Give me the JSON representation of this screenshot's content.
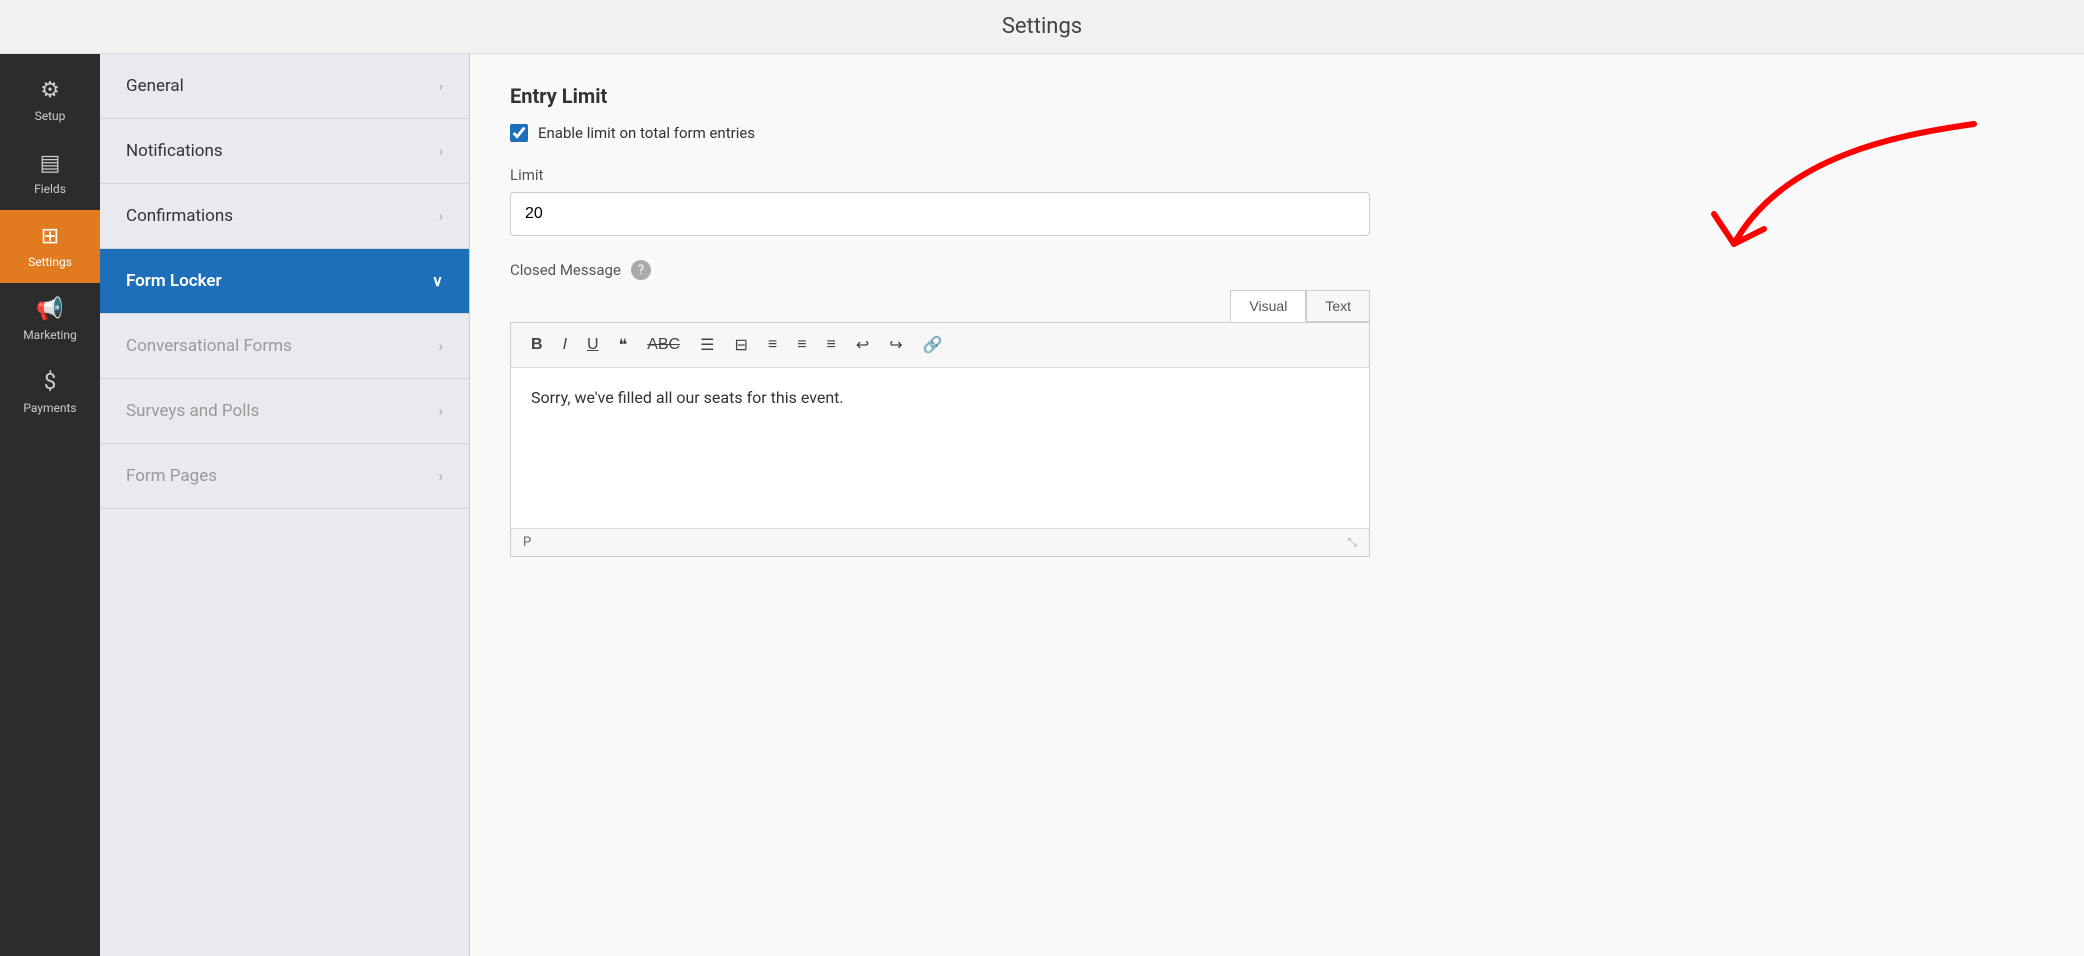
{
  "header": {
    "title": "Settings"
  },
  "left_nav": {
    "items": [
      {
        "id": "setup",
        "label": "Setup",
        "icon": "⚙",
        "active": false
      },
      {
        "id": "fields",
        "label": "Fields",
        "icon": "≡",
        "active": false
      },
      {
        "id": "settings",
        "label": "Settings",
        "icon": "⚡",
        "active": true
      },
      {
        "id": "marketing",
        "label": "Marketing",
        "icon": "📢",
        "active": false
      },
      {
        "id": "payments",
        "label": "Payments",
        "icon": "$",
        "active": false
      }
    ]
  },
  "sidebar": {
    "items": [
      {
        "id": "general",
        "label": "General",
        "active": false,
        "disabled": false,
        "chevron": "›"
      },
      {
        "id": "notifications",
        "label": "Notifications",
        "active": false,
        "disabled": false,
        "chevron": "›"
      },
      {
        "id": "confirmations",
        "label": "Confirmations",
        "active": false,
        "disabled": false,
        "chevron": "›"
      },
      {
        "id": "form-locker",
        "label": "Form Locker",
        "active": true,
        "disabled": false,
        "chevron": "∨"
      },
      {
        "id": "conversational-forms",
        "label": "Conversational Forms",
        "active": false,
        "disabled": true,
        "chevron": "›"
      },
      {
        "id": "surveys-and-polls",
        "label": "Surveys and Polls",
        "active": false,
        "disabled": true,
        "chevron": "›"
      },
      {
        "id": "form-pages",
        "label": "Form Pages",
        "active": false,
        "disabled": true,
        "chevron": "›"
      }
    ]
  },
  "main": {
    "section_title": "Entry Limit",
    "checkbox_label": "Enable limit on total form entries",
    "checkbox_checked": true,
    "limit_label": "Limit",
    "limit_value": "20",
    "closed_message_label": "Closed Message",
    "help_icon": "?",
    "editor_tabs": [
      {
        "id": "visual",
        "label": "Visual",
        "active": true
      },
      {
        "id": "text",
        "label": "Text",
        "active": false
      }
    ],
    "toolbar_buttons": [
      {
        "id": "bold",
        "symbol": "B",
        "title": "Bold"
      },
      {
        "id": "italic",
        "symbol": "I",
        "title": "Italic"
      },
      {
        "id": "underline",
        "symbol": "U",
        "title": "Underline"
      },
      {
        "id": "blockquote",
        "symbol": "❝",
        "title": "Blockquote"
      },
      {
        "id": "strikethrough",
        "symbol": "ABC̶",
        "title": "Strikethrough"
      },
      {
        "id": "unordered-list",
        "symbol": "≡•",
        "title": "Unordered List"
      },
      {
        "id": "ordered-list",
        "symbol": "1.",
        "title": "Ordered List"
      },
      {
        "id": "align-left",
        "symbol": "≡",
        "title": "Align Left"
      },
      {
        "id": "align-center",
        "symbol": "≡",
        "title": "Align Center"
      },
      {
        "id": "align-right",
        "symbol": "≡",
        "title": "Align Right"
      },
      {
        "id": "undo",
        "symbol": "↩",
        "title": "Undo"
      },
      {
        "id": "redo",
        "symbol": "↪",
        "title": "Redo"
      },
      {
        "id": "link",
        "symbol": "🔗",
        "title": "Link"
      }
    ],
    "editor_content": "Sorry, we've filled all our seats for this event.",
    "editor_footer_tag": "P"
  }
}
